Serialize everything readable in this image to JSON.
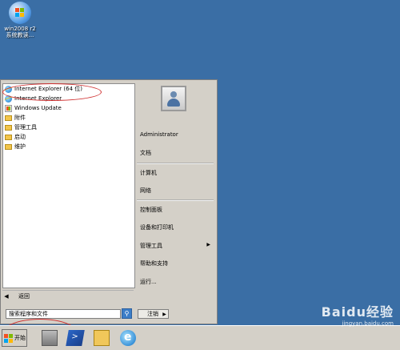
{
  "desktop": {
    "icon": {
      "icon_name": "windows-logo-icon",
      "label_line1": "win2008 r2",
      "label_line2": "系统教读..."
    }
  },
  "start_menu": {
    "programs": [
      {
        "label": "Internet Explorer (64 位)",
        "icon": "ie-icon"
      },
      {
        "label": "Internet Explorer",
        "icon": "ie-icon"
      },
      {
        "label": "Windows Update",
        "icon": "windows-update-icon"
      },
      {
        "label": "附件",
        "icon": "folder-icon"
      },
      {
        "label": "管理工具",
        "icon": "folder-icon"
      },
      {
        "label": "启动",
        "icon": "folder-icon"
      },
      {
        "label": "维护",
        "icon": "folder-icon"
      }
    ],
    "back_label": "返回",
    "search_placeholder": "搜索程序和文件",
    "right_items": [
      {
        "label": "Administrator"
      },
      {
        "label": "文档"
      },
      {
        "label": "计算机"
      },
      {
        "label": "网络"
      },
      {
        "label": "控制面板"
      },
      {
        "label": "设备和打印机"
      },
      {
        "label": "管理工具"
      },
      {
        "label": "帮助和支持"
      },
      {
        "label": "运行..."
      }
    ],
    "logoff_label": "注销"
  },
  "taskbar": {
    "start_label": "开始",
    "pinned": [
      "server-manager-icon",
      "powershell-icon",
      "explorer-icon",
      "ie-icon"
    ]
  },
  "watermark": {
    "brand": "Baidu经验",
    "sub": "jingyan.baidu.com"
  },
  "colors": {
    "desktop": "#3a6ea5",
    "annotation": "#d03030",
    "taskbar": "#d4d0c8"
  }
}
